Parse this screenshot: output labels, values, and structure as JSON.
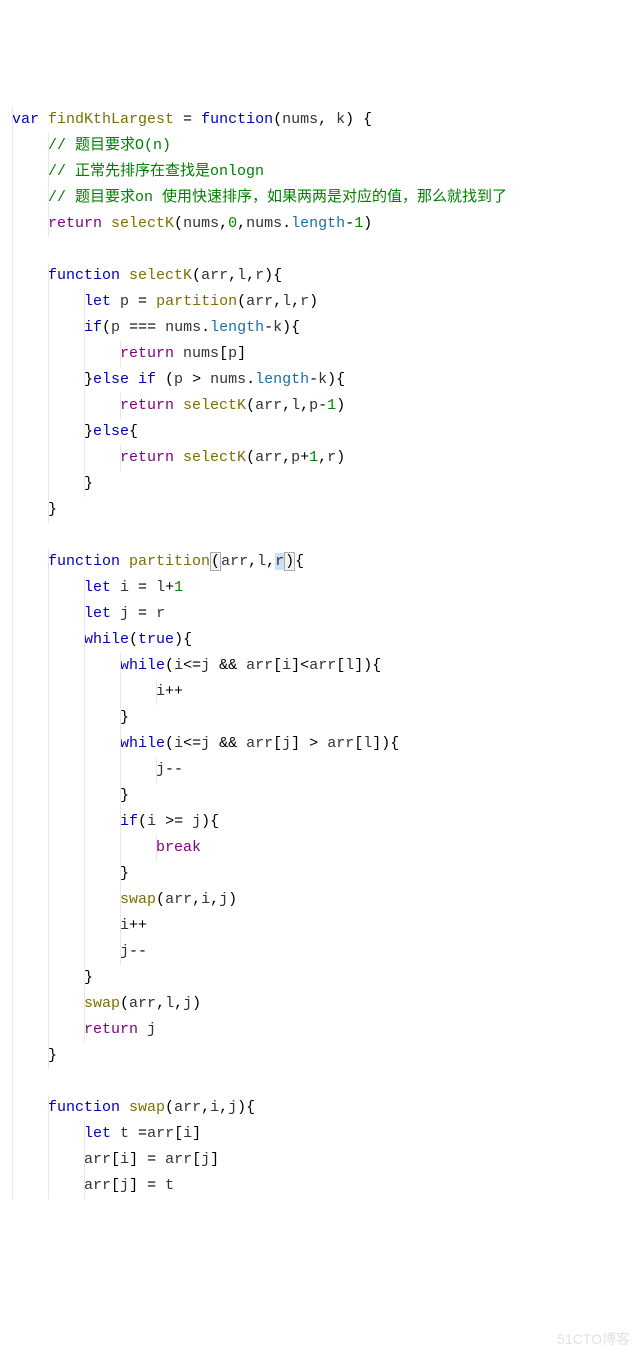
{
  "watermark": "51CTO博客",
  "code": {
    "lines": [
      [
        {
          "t": "var ",
          "c": "kw-blue"
        },
        {
          "t": "findKthLargest",
          "c": "fn-yellow"
        },
        {
          "t": " = ",
          "c": "op"
        },
        {
          "t": "function",
          "c": "kw-blue"
        },
        {
          "t": "(",
          "c": "op"
        },
        {
          "t": "nums",
          "c": "ident"
        },
        {
          "t": ", ",
          "c": "op"
        },
        {
          "t": "k",
          "c": "ident"
        },
        {
          "t": ") {",
          "c": "op"
        }
      ],
      [
        {
          "t": "    ",
          "c": ""
        },
        {
          "t": "// 题目要求O(n)",
          "c": "comment"
        }
      ],
      [
        {
          "t": "    ",
          "c": ""
        },
        {
          "t": "// 正常先排序在查找是onlogn",
          "c": "comment"
        }
      ],
      [
        {
          "t": "    ",
          "c": ""
        },
        {
          "t": "// 题目要求on 使用快速排序，如果两两是对应的值，那么就找到了",
          "c": "comment"
        }
      ],
      [
        {
          "t": "    ",
          "c": ""
        },
        {
          "t": "return ",
          "c": "kw-purple"
        },
        {
          "t": "selectK",
          "c": "fn-yellow"
        },
        {
          "t": "(",
          "c": "op"
        },
        {
          "t": "nums",
          "c": "ident"
        },
        {
          "t": ",",
          "c": "op"
        },
        {
          "t": "0",
          "c": "num"
        },
        {
          "t": ",",
          "c": "op"
        },
        {
          "t": "nums",
          "c": "ident"
        },
        {
          "t": ".",
          "c": "op"
        },
        {
          "t": "length",
          "c": "param"
        },
        {
          "t": "-",
          "c": "op"
        },
        {
          "t": "1",
          "c": "num"
        },
        {
          "t": ")",
          "c": "op"
        }
      ],
      [
        {
          "t": " ",
          "c": ""
        }
      ],
      [
        {
          "t": "    ",
          "c": ""
        },
        {
          "t": "function ",
          "c": "kw-blue"
        },
        {
          "t": "selectK",
          "c": "fn-yellow"
        },
        {
          "t": "(",
          "c": "op"
        },
        {
          "t": "arr",
          "c": "ident"
        },
        {
          "t": ",",
          "c": "op"
        },
        {
          "t": "l",
          "c": "ident"
        },
        {
          "t": ",",
          "c": "op"
        },
        {
          "t": "r",
          "c": "ident"
        },
        {
          "t": "){",
          "c": "op"
        }
      ],
      [
        {
          "t": "        ",
          "c": ""
        },
        {
          "t": "let ",
          "c": "kw-blue"
        },
        {
          "t": "p",
          "c": "ident"
        },
        {
          "t": " = ",
          "c": "op"
        },
        {
          "t": "partition",
          "c": "fn-yellow"
        },
        {
          "t": "(",
          "c": "op"
        },
        {
          "t": "arr",
          "c": "ident"
        },
        {
          "t": ",",
          "c": "op"
        },
        {
          "t": "l",
          "c": "ident"
        },
        {
          "t": ",",
          "c": "op"
        },
        {
          "t": "r",
          "c": "ident"
        },
        {
          "t": ")",
          "c": "op"
        }
      ],
      [
        {
          "t": "        ",
          "c": ""
        },
        {
          "t": "if",
          "c": "kw-blue"
        },
        {
          "t": "(",
          "c": "op"
        },
        {
          "t": "p",
          "c": "ident"
        },
        {
          "t": " === ",
          "c": "op"
        },
        {
          "t": "nums",
          "c": "ident"
        },
        {
          "t": ".",
          "c": "op"
        },
        {
          "t": "length",
          "c": "param"
        },
        {
          "t": "-",
          "c": "op"
        },
        {
          "t": "k",
          "c": "ident"
        },
        {
          "t": "){",
          "c": "op"
        }
      ],
      [
        {
          "t": "            ",
          "c": ""
        },
        {
          "t": "return ",
          "c": "kw-purple"
        },
        {
          "t": "nums",
          "c": "ident"
        },
        {
          "t": "[",
          "c": "op"
        },
        {
          "t": "p",
          "c": "ident"
        },
        {
          "t": "]",
          "c": "op"
        }
      ],
      [
        {
          "t": "        }",
          "c": "op"
        },
        {
          "t": "else if ",
          "c": "kw-blue"
        },
        {
          "t": "(",
          "c": "op"
        },
        {
          "t": "p",
          "c": "ident"
        },
        {
          "t": " > ",
          "c": "op"
        },
        {
          "t": "nums",
          "c": "ident"
        },
        {
          "t": ".",
          "c": "op"
        },
        {
          "t": "length",
          "c": "param"
        },
        {
          "t": "-",
          "c": "op"
        },
        {
          "t": "k",
          "c": "ident"
        },
        {
          "t": "){",
          "c": "op"
        }
      ],
      [
        {
          "t": "            ",
          "c": ""
        },
        {
          "t": "return ",
          "c": "kw-purple"
        },
        {
          "t": "selectK",
          "c": "fn-yellow"
        },
        {
          "t": "(",
          "c": "op"
        },
        {
          "t": "arr",
          "c": "ident"
        },
        {
          "t": ",",
          "c": "op"
        },
        {
          "t": "l",
          "c": "ident"
        },
        {
          "t": ",",
          "c": "op"
        },
        {
          "t": "p",
          "c": "ident"
        },
        {
          "t": "-",
          "c": "op"
        },
        {
          "t": "1",
          "c": "num"
        },
        {
          "t": ")",
          "c": "op"
        }
      ],
      [
        {
          "t": "        }",
          "c": "op"
        },
        {
          "t": "else",
          "c": "kw-blue"
        },
        {
          "t": "{",
          "c": "op"
        }
      ],
      [
        {
          "t": "            ",
          "c": ""
        },
        {
          "t": "return ",
          "c": "kw-purple"
        },
        {
          "t": "selectK",
          "c": "fn-yellow"
        },
        {
          "t": "(",
          "c": "op"
        },
        {
          "t": "arr",
          "c": "ident"
        },
        {
          "t": ",",
          "c": "op"
        },
        {
          "t": "p",
          "c": "ident"
        },
        {
          "t": "+",
          "c": "op"
        },
        {
          "t": "1",
          "c": "num"
        },
        {
          "t": ",",
          "c": "op"
        },
        {
          "t": "r",
          "c": "ident"
        },
        {
          "t": ")",
          "c": "op"
        }
      ],
      [
        {
          "t": "        }",
          "c": "op"
        }
      ],
      [
        {
          "t": "    }",
          "c": "op"
        }
      ],
      [
        {
          "t": " ",
          "c": ""
        }
      ],
      [
        {
          "t": "    ",
          "c": ""
        },
        {
          "t": "function ",
          "c": "kw-blue"
        },
        {
          "t": "partition",
          "c": "fn-yellow"
        },
        {
          "t": "(",
          "c": "op hl-box"
        },
        {
          "t": "arr",
          "c": "ident"
        },
        {
          "t": ",",
          "c": "op"
        },
        {
          "t": "l",
          "c": "ident"
        },
        {
          "t": ",",
          "c": "op"
        },
        {
          "t": "r",
          "c": "ident hl-sel"
        },
        {
          "t": ")",
          "c": "op hl-box"
        },
        {
          "t": "{",
          "c": "op"
        }
      ],
      [
        {
          "t": "        ",
          "c": ""
        },
        {
          "t": "let ",
          "c": "kw-blue"
        },
        {
          "t": "i",
          "c": "ident"
        },
        {
          "t": " = ",
          "c": "op"
        },
        {
          "t": "l",
          "c": "ident"
        },
        {
          "t": "+",
          "c": "op"
        },
        {
          "t": "1",
          "c": "num"
        }
      ],
      [
        {
          "t": "        ",
          "c": ""
        },
        {
          "t": "let ",
          "c": "kw-blue"
        },
        {
          "t": "j",
          "c": "ident"
        },
        {
          "t": " = ",
          "c": "op"
        },
        {
          "t": "r",
          "c": "ident"
        }
      ],
      [
        {
          "t": "        ",
          "c": ""
        },
        {
          "t": "while",
          "c": "kw-blue"
        },
        {
          "t": "(",
          "c": "op"
        },
        {
          "t": "true",
          "c": "kw-blue"
        },
        {
          "t": "){",
          "c": "op"
        }
      ],
      [
        {
          "t": "            ",
          "c": ""
        },
        {
          "t": "while",
          "c": "kw-blue"
        },
        {
          "t": "(",
          "c": "op"
        },
        {
          "t": "i",
          "c": "ident"
        },
        {
          "t": "<=",
          "c": "op"
        },
        {
          "t": "j",
          "c": "ident"
        },
        {
          "t": " && ",
          "c": "op"
        },
        {
          "t": "arr",
          "c": "ident"
        },
        {
          "t": "[",
          "c": "op"
        },
        {
          "t": "i",
          "c": "ident"
        },
        {
          "t": "]<",
          "c": "op"
        },
        {
          "t": "arr",
          "c": "ident"
        },
        {
          "t": "[",
          "c": "op"
        },
        {
          "t": "l",
          "c": "ident"
        },
        {
          "t": "]){",
          "c": "op"
        }
      ],
      [
        {
          "t": "                ",
          "c": ""
        },
        {
          "t": "i",
          "c": "ident"
        },
        {
          "t": "++",
          "c": "op"
        }
      ],
      [
        {
          "t": "            }",
          "c": "op"
        }
      ],
      [
        {
          "t": "            ",
          "c": ""
        },
        {
          "t": "while",
          "c": "kw-blue"
        },
        {
          "t": "(",
          "c": "op"
        },
        {
          "t": "i",
          "c": "ident"
        },
        {
          "t": "<=",
          "c": "op"
        },
        {
          "t": "j",
          "c": "ident"
        },
        {
          "t": " && ",
          "c": "op"
        },
        {
          "t": "arr",
          "c": "ident"
        },
        {
          "t": "[",
          "c": "op"
        },
        {
          "t": "j",
          "c": "ident"
        },
        {
          "t": "] > ",
          "c": "op"
        },
        {
          "t": "arr",
          "c": "ident"
        },
        {
          "t": "[",
          "c": "op"
        },
        {
          "t": "l",
          "c": "ident"
        },
        {
          "t": "]){",
          "c": "op"
        }
      ],
      [
        {
          "t": "                ",
          "c": ""
        },
        {
          "t": "j",
          "c": "ident"
        },
        {
          "t": "--",
          "c": "op"
        }
      ],
      [
        {
          "t": "            }",
          "c": "op"
        }
      ],
      [
        {
          "t": "            ",
          "c": ""
        },
        {
          "t": "if",
          "c": "kw-blue"
        },
        {
          "t": "(",
          "c": "op"
        },
        {
          "t": "i",
          "c": "ident"
        },
        {
          "t": " >= ",
          "c": "op"
        },
        {
          "t": "j",
          "c": "ident"
        },
        {
          "t": "){",
          "c": "op"
        }
      ],
      [
        {
          "t": "                ",
          "c": ""
        },
        {
          "t": "break",
          "c": "kw-purple"
        }
      ],
      [
        {
          "t": "            }",
          "c": "op"
        }
      ],
      [
        {
          "t": "            ",
          "c": ""
        },
        {
          "t": "swap",
          "c": "fn-yellow"
        },
        {
          "t": "(",
          "c": "op"
        },
        {
          "t": "arr",
          "c": "ident"
        },
        {
          "t": ",",
          "c": "op"
        },
        {
          "t": "i",
          "c": "ident"
        },
        {
          "t": ",",
          "c": "op"
        },
        {
          "t": "j",
          "c": "ident"
        },
        {
          "t": ")",
          "c": "op"
        }
      ],
      [
        {
          "t": "            ",
          "c": ""
        },
        {
          "t": "i",
          "c": "ident"
        },
        {
          "t": "++",
          "c": "op"
        }
      ],
      [
        {
          "t": "            ",
          "c": ""
        },
        {
          "t": "j",
          "c": "ident"
        },
        {
          "t": "--",
          "c": "op"
        }
      ],
      [
        {
          "t": "        }",
          "c": "op"
        }
      ],
      [
        {
          "t": "        ",
          "c": ""
        },
        {
          "t": "swap",
          "c": "fn-yellow"
        },
        {
          "t": "(",
          "c": "op"
        },
        {
          "t": "arr",
          "c": "ident"
        },
        {
          "t": ",",
          "c": "op"
        },
        {
          "t": "l",
          "c": "ident"
        },
        {
          "t": ",",
          "c": "op"
        },
        {
          "t": "j",
          "c": "ident"
        },
        {
          "t": ")",
          "c": "op"
        }
      ],
      [
        {
          "t": "        ",
          "c": ""
        },
        {
          "t": "return ",
          "c": "kw-purple"
        },
        {
          "t": "j",
          "c": "ident"
        }
      ],
      [
        {
          "t": "    }",
          "c": "op"
        }
      ],
      [
        {
          "t": " ",
          "c": ""
        }
      ],
      [
        {
          "t": "    ",
          "c": ""
        },
        {
          "t": "function ",
          "c": "kw-blue"
        },
        {
          "t": "swap",
          "c": "fn-yellow"
        },
        {
          "t": "(",
          "c": "op"
        },
        {
          "t": "arr",
          "c": "ident"
        },
        {
          "t": ",",
          "c": "op"
        },
        {
          "t": "i",
          "c": "ident"
        },
        {
          "t": ",",
          "c": "op"
        },
        {
          "t": "j",
          "c": "ident"
        },
        {
          "t": "){",
          "c": "op"
        }
      ],
      [
        {
          "t": "        ",
          "c": ""
        },
        {
          "t": "let ",
          "c": "kw-blue"
        },
        {
          "t": "t",
          "c": "ident"
        },
        {
          "t": " =",
          "c": "op"
        },
        {
          "t": "arr",
          "c": "ident"
        },
        {
          "t": "[",
          "c": "op"
        },
        {
          "t": "i",
          "c": "ident"
        },
        {
          "t": "]",
          "c": "op"
        }
      ],
      [
        {
          "t": "        ",
          "c": ""
        },
        {
          "t": "arr",
          "c": "ident"
        },
        {
          "t": "[",
          "c": "op"
        },
        {
          "t": "i",
          "c": "ident"
        },
        {
          "t": "] = ",
          "c": "op"
        },
        {
          "t": "arr",
          "c": "ident"
        },
        {
          "t": "[",
          "c": "op"
        },
        {
          "t": "j",
          "c": "ident"
        },
        {
          "t": "]",
          "c": "op"
        }
      ],
      [
        {
          "t": "        ",
          "c": ""
        },
        {
          "t": "arr",
          "c": "ident"
        },
        {
          "t": "[",
          "c": "op"
        },
        {
          "t": "j",
          "c": "ident"
        },
        {
          "t": "] = ",
          "c": "op"
        },
        {
          "t": "t",
          "c": "ident"
        }
      ]
    ]
  }
}
